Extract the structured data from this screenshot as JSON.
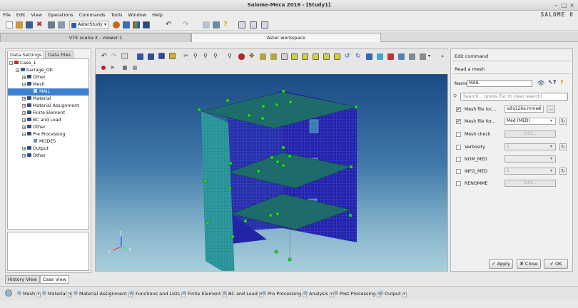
{
  "window": {
    "title": "Salome-Meca 2016 - [Study1]",
    "logo": "SALOME 8"
  },
  "menu": [
    "File",
    "Edit",
    "View",
    "Operations",
    "Commands",
    "Tools",
    "Window",
    "Help"
  ],
  "toolbar": {
    "module_selector": "AsterStudy"
  },
  "tabs": {
    "vtk": "VTK scene:3 - viewer:1",
    "aster": "Aster workspace"
  },
  "left": {
    "tabs": [
      "Data Settings",
      "Data Files"
    ],
    "tree": [
      "Case_1",
      "barrage_OK",
      "Other",
      "Mesh",
      "MAIL",
      "Material",
      "Material Assignment",
      "Finite Element",
      "BC and Load",
      "Other",
      "Pre Processing",
      "MODES",
      "Output",
      "Other"
    ],
    "bottom_tabs": [
      "History View",
      "Case View"
    ]
  },
  "panel": {
    "header": "Edit command",
    "subheader": "Read a mesh",
    "name_label": "Name",
    "name_value": "MAIL",
    "search_placeholder": "Search... (press Esc to clear search)",
    "params": [
      {
        "label": "Mesh file loc...",
        "checked": true,
        "value": "sdls126a.mmed",
        "button": "...",
        "button_disabled": false
      },
      {
        "label": "Mesh file for...",
        "checked": true,
        "value": "Med (MED)",
        "reset": "↻"
      },
      {
        "label": "Mesh check",
        "checked": false,
        "button": "Edit...",
        "button_disabled": true
      },
      {
        "label": "Verbosity",
        "checked": false,
        "value": "1",
        "reset": "↻"
      },
      {
        "label": "NOM_MED",
        "checked": false,
        "value": ""
      },
      {
        "label": "INFO_MED",
        "checked": false,
        "value": "1",
        "reset": "↻"
      },
      {
        "label": "RENOMME",
        "checked": false,
        "button": "Edit...",
        "button_disabled": true
      }
    ],
    "apply": "Apply",
    "close": "Close",
    "ok": "OK"
  },
  "axes": {
    "x": "X",
    "y": "Y",
    "z": "Z"
  },
  "bottom_toolbar": [
    "Mesh",
    "Material",
    "Material Assignment",
    "Functions and Lists",
    "Finite Element",
    "BC and Load",
    "Pre Processing",
    "Analysis",
    "Post Processing",
    "Output"
  ],
  "colors": {
    "accent": "#3a7fd0",
    "mesh_blue": "#2323a8",
    "slab": "#1d6b6b",
    "node": "#1ee01e",
    "wall": "#2f9aa0"
  }
}
